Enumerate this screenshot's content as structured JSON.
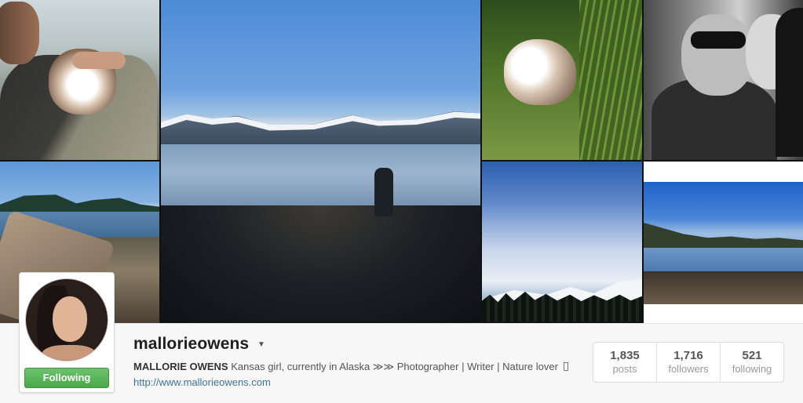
{
  "profile": {
    "username": "mallorieowens",
    "full_name": "MALLORIE OWENS",
    "bio": "Kansas girl, currently in Alaska ≫≫ Photographer | Writer | Nature lover",
    "website": "http://www.mallorieowens.com",
    "follow_button_label": "Following",
    "follow_button_color": "#4aa84a"
  },
  "stats": [
    {
      "value": "1,835",
      "label": "posts"
    },
    {
      "value": "1,716",
      "label": "followers"
    },
    {
      "value": "521",
      "label": "following"
    }
  ],
  "icons": {
    "caret": "chevron-down-icon",
    "bio_glyph": "unknown-glyph-icon"
  }
}
